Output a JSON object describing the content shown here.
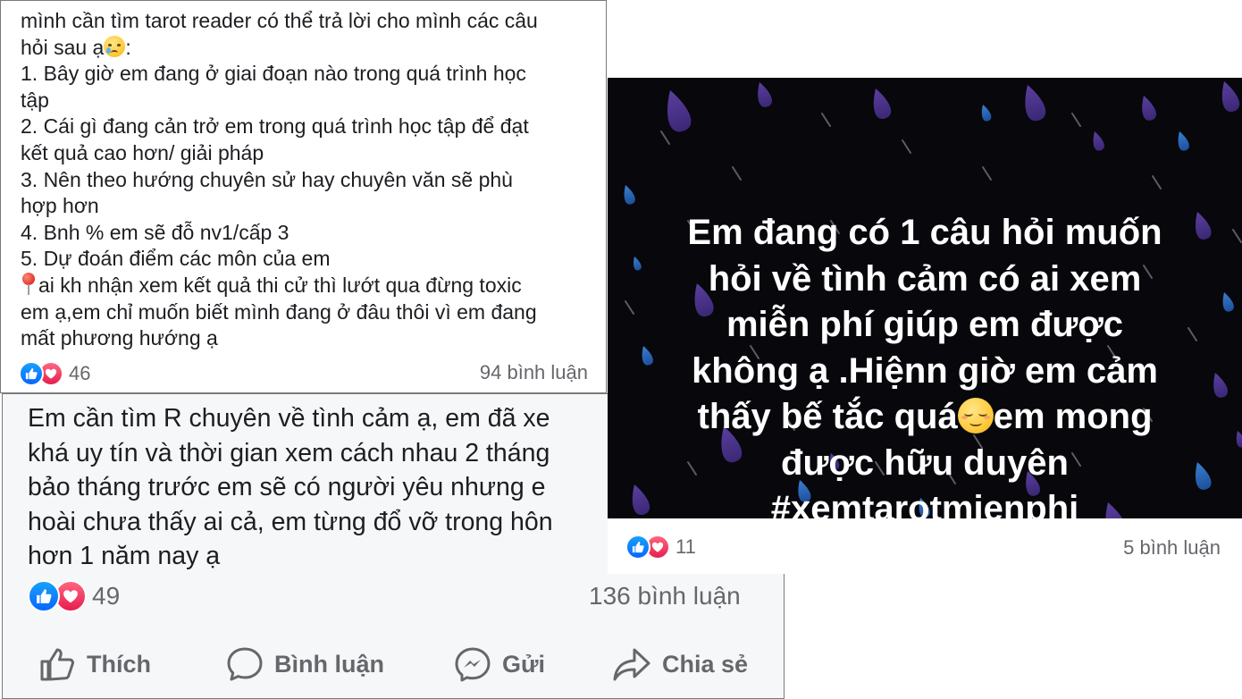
{
  "post1": {
    "lines": [
      "mình cần tìm tarot reader có thể trả lời cho mình các câu",
      "hỏi sau ạ",
      "1. Bây giờ em đang ở giai đoạn nào trong quá trình học",
      "tập",
      "2. Cái gì đang cản trở em trong quá trình học tập để đạt",
      "kết quả cao hơn/ giải pháp",
      "3. Nên theo hướng chuyên sử hay chuyên văn sẽ phù",
      "hợp hơn",
      "4. Bnh % em sẽ đỗ nv1/cấp 3",
      "5. Dự đoán điểm các môn của em",
      "ai kh nhận xem kết quả thi cử thì lướt qua đừng toxic",
      "em ạ,em chỉ muốn biết mình đang ở đâu thôi vì em đang",
      "mất phương hướng ạ"
    ],
    "line2_suffix": ":",
    "reaction_count": "46",
    "comment_count": "94 bình luận",
    "icons": [
      "crying-face-emoji",
      "round-pushpin-emoji",
      "like-reaction",
      "love-reaction"
    ]
  },
  "post2": {
    "lines": [
      "Em cần tìm R chuyên về tình cảm ạ, em đã xe",
      "khá uy tín và thời gian xem cách nhau 2 tháng",
      "bảo tháng trước em sẽ có người yêu nhưng e",
      "hoài chưa thấy ai cả, em từng đổ vỡ trong hôn",
      "hơn 1 năm nay ạ"
    ],
    "reaction_count": "49",
    "comment_count": "136 bình luận",
    "actions": {
      "like": "Thích",
      "comment": "Bình luận",
      "send": "Gửi",
      "share": "Chia sẻ"
    },
    "icons": [
      "like-reaction",
      "love-reaction",
      "thumbs-up-icon",
      "comment-bubble-icon",
      "messenger-icon",
      "share-arrow-icon"
    ]
  },
  "post3": {
    "caption_lines": [
      "Em đang có 1 câu hỏi muốn",
      "hỏi về tình cảm có ai xem",
      "miễn phí giúp em được",
      "không ạ .Hiệnn giờ em cảm",
      "thấy bế tắc quá",
      "em mong",
      "được hữu duyên"
    ],
    "hashtag": "#xemtarotmienphi",
    "reaction_count": "11",
    "comment_count": "5 bình luận",
    "background": "dark rain drops",
    "icons": [
      "relieved-face-emoji",
      "like-reaction",
      "love-reaction"
    ]
  },
  "colors": {
    "text": "#1c1e21",
    "secondary": "#65676b",
    "like_blue": "#0866ff",
    "love_red": "#e61e4d",
    "image_bg": "#07070c"
  }
}
